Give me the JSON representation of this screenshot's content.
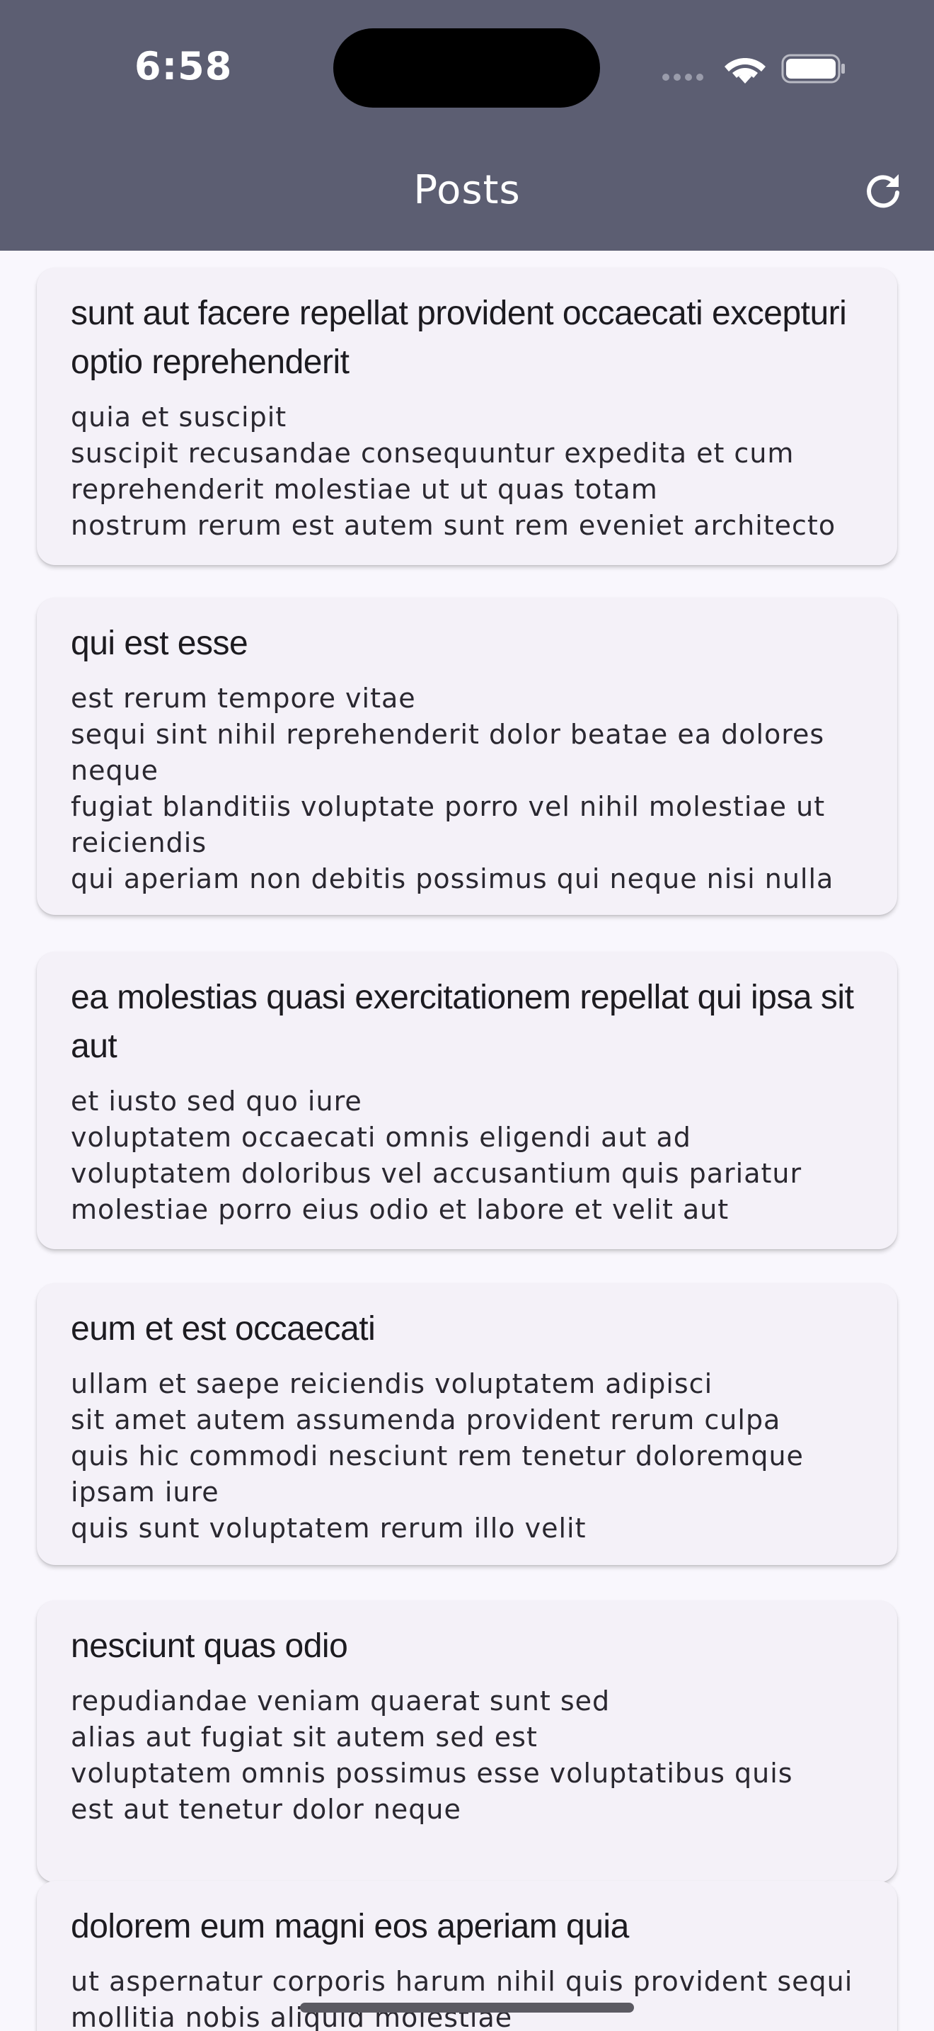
{
  "status_bar": {
    "time": "6:58"
  },
  "app_bar": {
    "title": "Posts",
    "refresh_icon": "refresh-icon"
  },
  "posts": [
    {
      "title": "sunt aut facere repellat provident occaecati excepturi optio reprehenderit",
      "body": "quia et suscipit\nsuscipit recusandae consequuntur expedita et cum reprehenderit molestiae ut ut quas totam\nnostrum rerum est autem sunt rem eveniet architecto"
    },
    {
      "title": "qui est esse",
      "body": "est rerum tempore vitae\nsequi sint nihil reprehenderit dolor beatae ea dolores neque\nfugiat blanditiis voluptate porro vel nihil molestiae ut reiciendis\nqui aperiam non debitis possimus qui neque nisi nulla"
    },
    {
      "title": "ea molestias quasi exercitationem repellat qui ipsa sit aut",
      "body": "et iusto sed quo iure\nvoluptatem occaecati omnis eligendi aut ad\nvoluptatem doloribus vel accusantium quis pariatur\nmolestiae porro eius odio et labore et velit aut"
    },
    {
      "title": "eum et est occaecati",
      "body": "ullam et saepe reiciendis voluptatem adipisci\nsit amet autem assumenda provident rerum culpa\nquis hic commodi nesciunt rem tenetur doloremque ipsam iure\nquis sunt voluptatem rerum illo velit"
    },
    {
      "title": "nesciunt quas odio",
      "body": "repudiandae veniam quaerat sunt sed\nalias aut fugiat sit autem sed est\nvoluptatem omnis possimus esse voluptatibus quis\nest aut tenetur dolor neque"
    },
    {
      "title": "dolorem eum magni eos aperiam quia",
      "body": "ut aspernatur corporis harum nihil quis provident sequi\nmollitia nobis aliquid molestiae"
    }
  ],
  "colors": {
    "app_bar": "#5c5e72",
    "background": "#f9f7fd",
    "card": "#f4f1f8",
    "text": "#1c1b20"
  }
}
